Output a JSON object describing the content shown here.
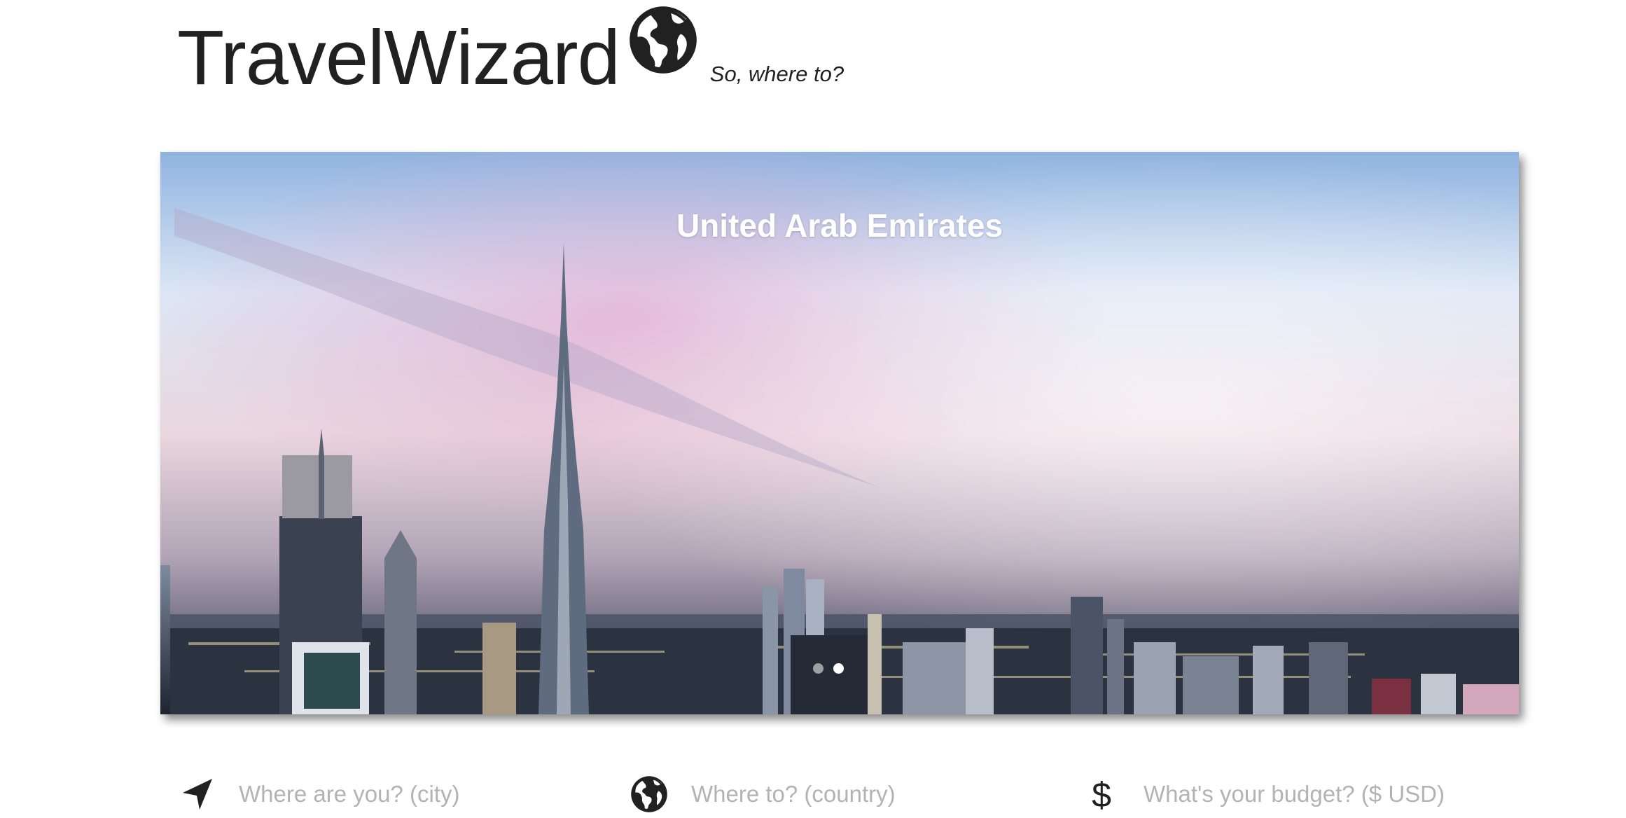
{
  "header": {
    "title": "TravelWizard",
    "tagline": "So, where to?",
    "logo_icon": "globe-icon"
  },
  "hero": {
    "country": "United Arab Emirates",
    "slide_count": 2,
    "active_slide": 2
  },
  "search": {
    "origin": {
      "placeholder": "Where are you? (city)",
      "icon": "navigation-arrow-icon",
      "value": ""
    },
    "destination": {
      "placeholder": "Where to? (country)",
      "icon": "globe-icon",
      "value": ""
    },
    "budget": {
      "placeholder": "What's your budget? ($ USD)",
      "icon": "dollar-icon",
      "value": ""
    }
  },
  "colors": {
    "text": "#212121",
    "placeholder": "#b3b3b3",
    "hero_title": "#ffffff"
  }
}
